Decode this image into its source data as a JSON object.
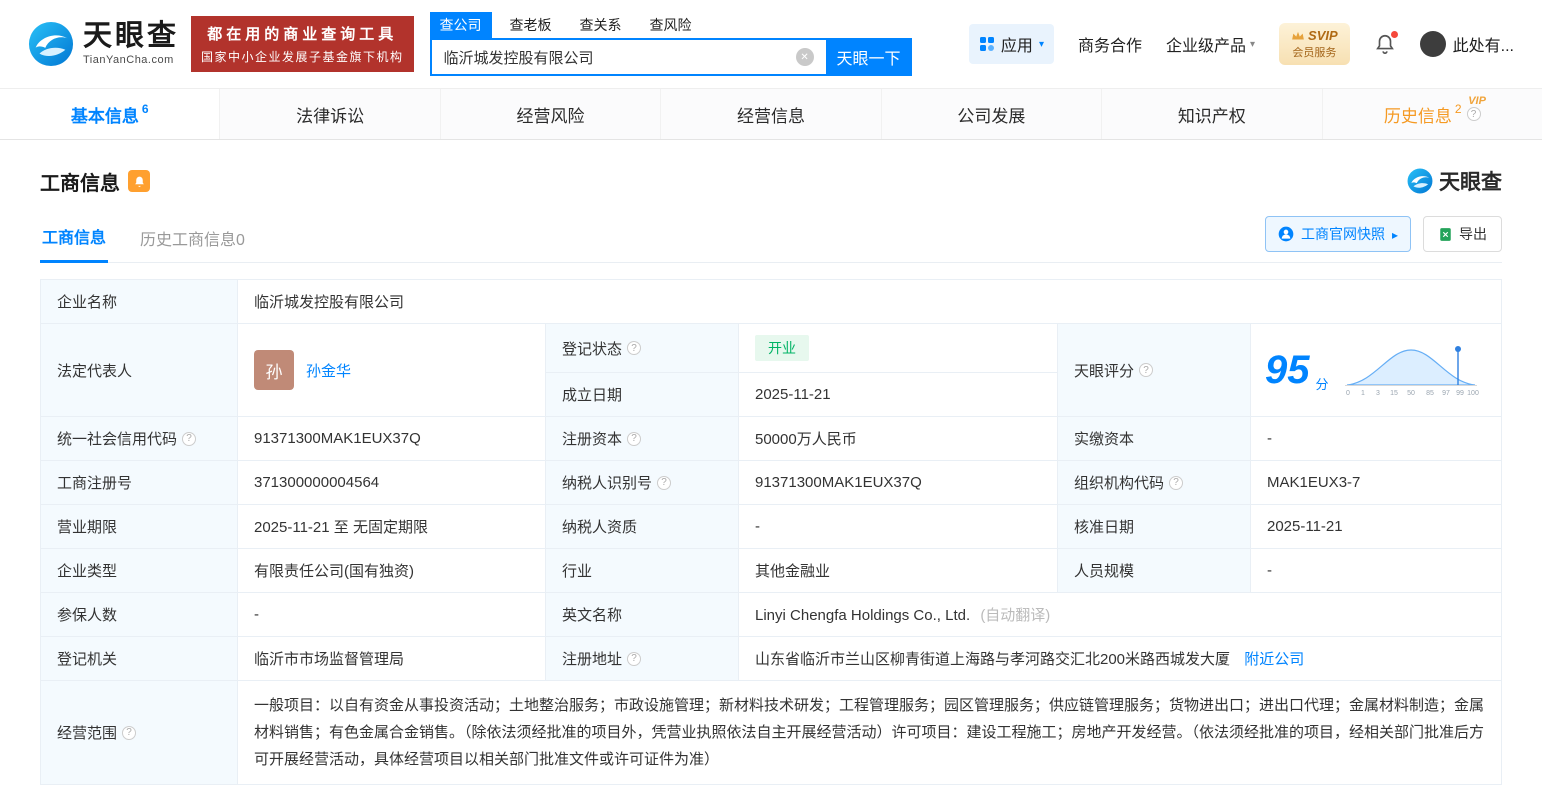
{
  "brand": {
    "name": "天眼查",
    "domain": "TianYanCha.com",
    "slogan1": "都在用的商业查询工具",
    "slogan2": "国家中小企业发展子基金旗下机构"
  },
  "search": {
    "tabs": [
      {
        "label": "查公司"
      },
      {
        "label": "查老板"
      },
      {
        "label": "查关系"
      },
      {
        "label": "查风险"
      }
    ],
    "value": "临沂城发控股有限公司",
    "button": "天眼一下"
  },
  "topnav": {
    "apps": "应用",
    "cooperation": "商务合作",
    "enterprise": "企业级产品",
    "svip_top": "SVIP",
    "svip_bottom": "会员服务",
    "user": "此处有..."
  },
  "tabs": [
    {
      "label": "基本信息",
      "count": "6"
    },
    {
      "label": "法律诉讼"
    },
    {
      "label": "经营风险"
    },
    {
      "label": "经营信息"
    },
    {
      "label": "公司发展"
    },
    {
      "label": "知识产权"
    },
    {
      "label": "历史信息",
      "count": "2",
      "vip": "VIP"
    }
  ],
  "section": {
    "title": "工商信息",
    "watermark": "天眼查",
    "subtab_active": "工商信息",
    "subtab_history": "历史工商信息0",
    "snapshot": "工商官网快照",
    "export": "导出"
  },
  "fields": {
    "company_name": {
      "label": "企业名称",
      "value": "临沂城发控股有限公司"
    },
    "legal_rep": {
      "label": "法定代表人",
      "avatar": "孙",
      "value": "孙金华"
    },
    "reg_status": {
      "label": "登记状态",
      "value": "开业"
    },
    "establish_date": {
      "label": "成立日期",
      "value": "2025-11-21"
    },
    "score": {
      "label": "天眼评分",
      "value": "95",
      "unit": "分",
      "axis": [
        "0",
        "1",
        "3",
        "15",
        "50",
        "85",
        "97",
        "99",
        "100"
      ]
    },
    "credit_code": {
      "label": "统一社会信用代码",
      "value": "91371300MAK1EUX37Q"
    },
    "reg_capital": {
      "label": "注册资本",
      "value": "50000万人民币"
    },
    "paid_capital": {
      "label": "实缴资本",
      "value": "-"
    },
    "reg_number": {
      "label": "工商注册号",
      "value": "371300000004564"
    },
    "taxpayer_id": {
      "label": "纳税人识别号",
      "value": "91371300MAK1EUX37Q"
    },
    "org_code": {
      "label": "组织机构代码",
      "value": "MAK1EUX3-7"
    },
    "business_term": {
      "label": "营业期限",
      "value": "2025-11-21 至 无固定期限"
    },
    "taxpayer_quality": {
      "label": "纳税人资质",
      "value": "-"
    },
    "approval_date": {
      "label": "核准日期",
      "value": "2025-11-21"
    },
    "company_type": {
      "label": "企业类型",
      "value": "有限责任公司(国有独资)"
    },
    "industry": {
      "label": "行业",
      "value": "其他金融业"
    },
    "staff_size": {
      "label": "人员规模",
      "value": "-"
    },
    "insured_count": {
      "label": "参保人数",
      "value": "-"
    },
    "english_name": {
      "label": "英文名称",
      "value": "Linyi Chengfa Holdings Co., Ltd.",
      "note": "(自动翻译)"
    },
    "reg_authority": {
      "label": "登记机关",
      "value": "临沂市市场监督管理局"
    },
    "reg_address": {
      "label": "注册地址",
      "value": "山东省临沂市兰山区柳青街道上海路与孝河路交汇北200米路西城发大厦",
      "link": "附近公司"
    },
    "business_scope": {
      "label": "经营范围",
      "value": "一般项目：以自有资金从事投资活动；土地整治服务；市政设施管理；新材料技术研发；工程管理服务；园区管理服务；供应链管理服务；货物进出口；进出口代理；金属材料制造；金属材料销售；有色金属合金销售。（除依法须经批准的项目外，凭营业执照依法自主开展经营活动）许可项目：建设工程施工；房地产开发经营。（依法须经批准的项目，经相关部门批准后方可开展经营活动，具体经营项目以相关部门批准文件或许可证件为准）"
    }
  },
  "colors": {
    "primary": "#0084ff",
    "badge_red": "#b2332c",
    "orange": "#f59a23",
    "green": "#00b365",
    "label_bg": "#f4fafe"
  }
}
